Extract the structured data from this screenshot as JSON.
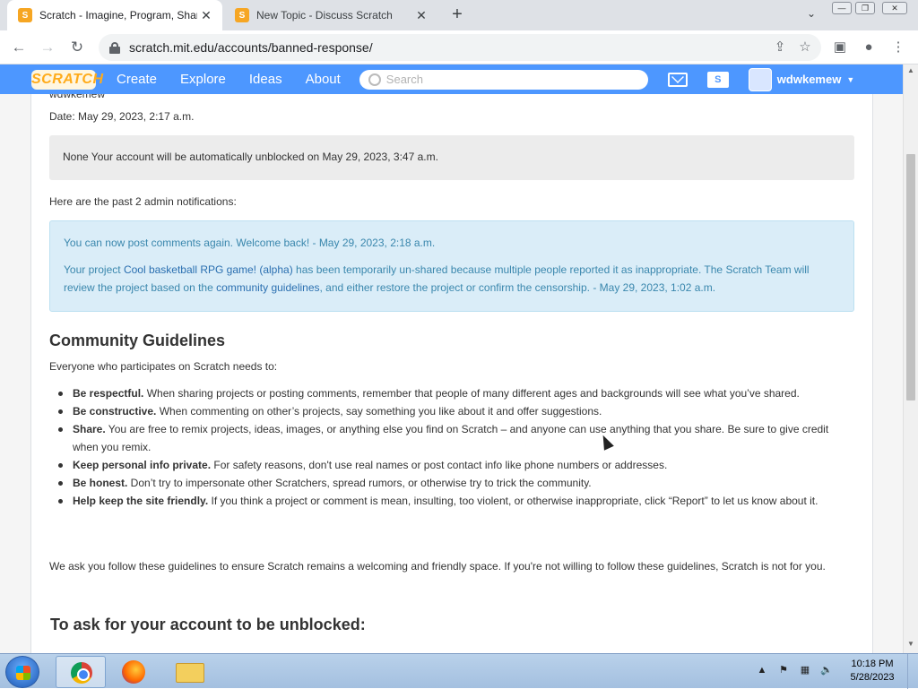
{
  "browser": {
    "tabs": [
      {
        "title": "Scratch - Imagine, Program, Shar",
        "close": "✕",
        "favicon": "S"
      },
      {
        "title": "New Topic - Discuss Scratch",
        "close": "✕",
        "favicon": "S"
      }
    ],
    "new_tab": "+",
    "tab_search": "⌄",
    "url": "scratch.mit.edu/accounts/banned-response/",
    "nav": {
      "back": "←",
      "forward": "→",
      "reload": "↻"
    },
    "toolbar_icons": {
      "share": "⇪",
      "star": "☆",
      "sidebar": "▣",
      "profile": "●",
      "menu": "⋮"
    },
    "window_buttons": {
      "minimize": "—",
      "restore": "❐",
      "close": "✕"
    }
  },
  "scratch_nav": {
    "logo": "SCRATCH",
    "links": [
      "Create",
      "Explore",
      "Ideas",
      "About"
    ],
    "search_placeholder": "Search",
    "mystuff_label": "S",
    "username": "wdwkemew",
    "caret": "▼"
  },
  "content": {
    "username": "wdwkemew",
    "date": "Date: May 29, 2023, 2:17 a.m.",
    "unblock_notice": "None Your account will be automatically unblocked on May 29, 2023, 3:47 a.m.",
    "notifications_intro": "Here are the past 2 admin notifications:",
    "notification_1": "You can now post comments again. Welcome back! - May 29, 2023, 2:18 a.m.",
    "notification_2": {
      "prefix": "Your project ",
      "project_link": "Cool basketball RPG game! (alpha)",
      "middle": " has been temporarily un-shared because multiple people reported it as inappropriate. The Scratch Team will review the project based on the ",
      "guidelines_link": "community guidelines",
      "suffix": ", and either restore the project or confirm the censorship. - May 29, 2023, 1:02 a.m."
    },
    "guidelines_heading": "Community Guidelines",
    "guidelines_intro": "Everyone who participates on Scratch needs to:",
    "guidelines": [
      {
        "title": "Be respectful.",
        "text": " When sharing projects or posting comments, remember that people of many different ages and backgrounds will see what you’ve shared."
      },
      {
        "title": "Be constructive.",
        "text": " When commenting on other’s projects, say something you like about it and offer suggestions."
      },
      {
        "title": "Share.",
        "text": " You are free to remix projects, ideas, images, or anything else you find on Scratch – and anyone can use anything that you share. Be sure to give credit when you remix."
      },
      {
        "title": "Keep personal info private.",
        "text": " For safety reasons, don't use real names or post contact info like phone numbers or addresses."
      },
      {
        "title": "Be honest.",
        "text": " Don’t try to impersonate other Scratchers, spread rumors, or otherwise try to trick the community."
      },
      {
        "title": "Help keep the site friendly.",
        "text": " If you think a project or comment is mean, insulting, too violent, or otherwise inappropriate, click “Report” to let us know about it."
      }
    ],
    "closing": "We ask you follow these guidelines to ensure Scratch remains a welcoming and friendly space. If you're not willing to follow these guidelines, Scratch is not for you.",
    "unblock_heading": "To ask for your account to be unblocked:"
  },
  "scrollbar": {
    "up": "▲",
    "down": "▼"
  },
  "taskbar": {
    "tray": {
      "chevron": "▲",
      "flag": "⚑",
      "network": "▦",
      "volume": "🔈"
    },
    "time": "10:18 PM",
    "date": "5/28/2023"
  }
}
